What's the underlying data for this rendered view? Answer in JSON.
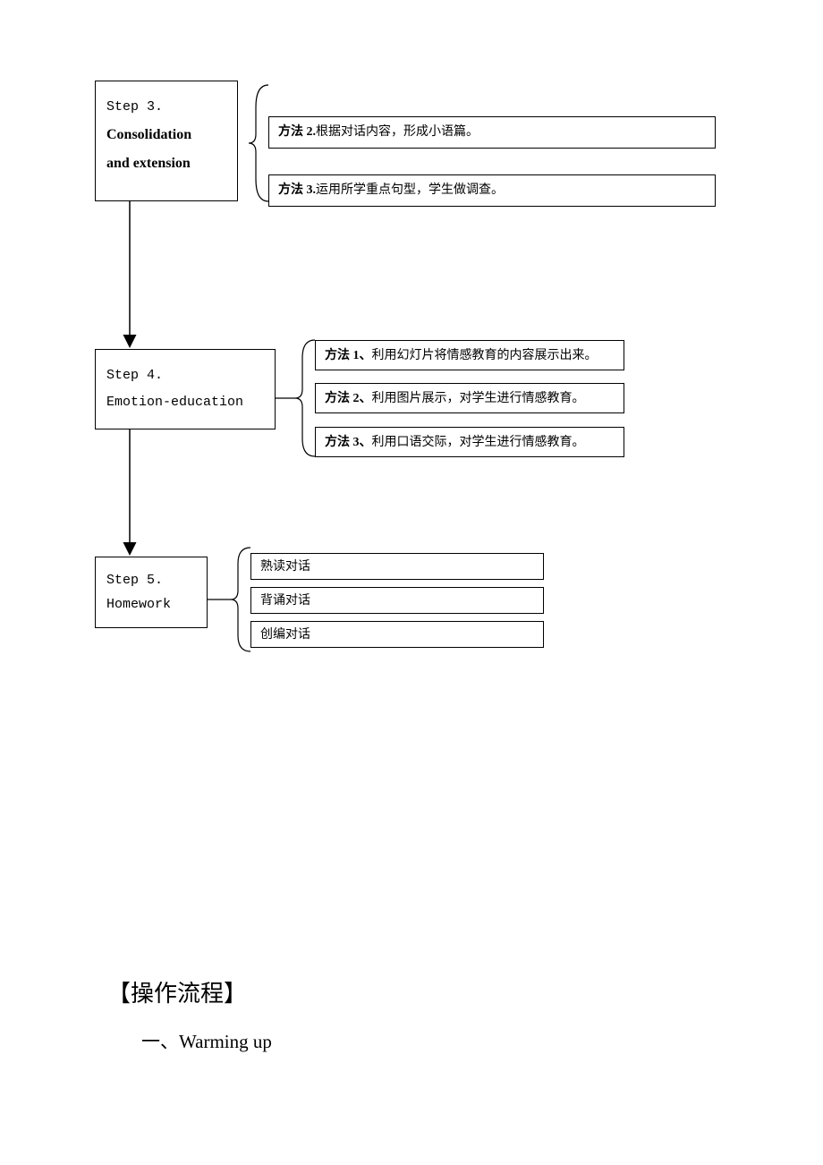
{
  "steps": {
    "s3": {
      "line1": "Step 3.",
      "line2": "Consolidation",
      "line3": "and extension"
    },
    "s4": {
      "line1": "Step 4.",
      "line2": "Emotion-education"
    },
    "s5": {
      "line1": "Step 5.",
      "line2": "Homework"
    }
  },
  "methods": {
    "s3": {
      "m2": {
        "label": "方法 2.",
        "text": "根据对话内容，形成小语篇。"
      },
      "m3": {
        "label": "方法 3.",
        "text": "运用所学重点句型，学生做调查。"
      }
    },
    "s4": {
      "m1": {
        "label": "方法 1、",
        "text": "利用幻灯片将情感教育的内容展示出来。"
      },
      "m2": {
        "label": "方法 2、",
        "text": "利用图片展示，对学生进行情感教育。"
      },
      "m3": {
        "label": "方法 3、",
        "text": "利用口语交际，对学生进行情感教育。"
      }
    },
    "s5": {
      "m1": {
        "text": "熟读对话"
      },
      "m2": {
        "text": "背诵对话"
      },
      "m3": {
        "text": "创编对话"
      }
    }
  },
  "headings": {
    "h1": "【操作流程】",
    "sub1_prefix": "一、",
    "sub1_text": "Warming up"
  }
}
